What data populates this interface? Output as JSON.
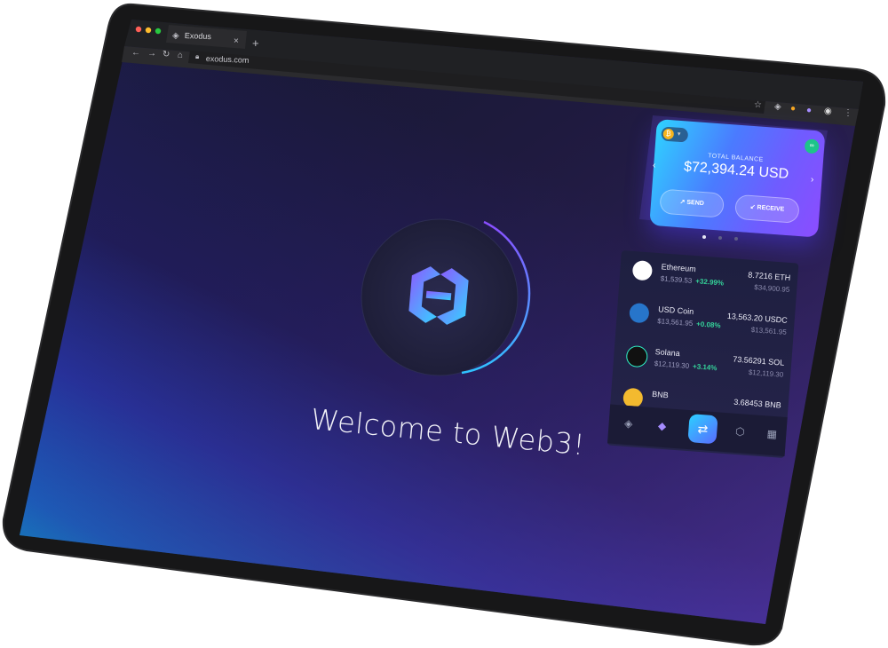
{
  "browser": {
    "tab_title": "Exodus",
    "url": "exodus.com",
    "new_tab_symbol": "+",
    "close_symbol": "×"
  },
  "main": {
    "welcome": "Welcome to Web3!"
  },
  "wallet": {
    "balance_label": "TOTAL BALANCE",
    "balance": "$72,394.24 USD",
    "send_label": "SEND",
    "receive_label": "RECEIVE",
    "assets": [
      {
        "name": "Ethereum",
        "price": "$1,539.53",
        "change": "+32.99%",
        "amount": "8.7216 ETH",
        "fiat": "$34,900.95",
        "icon": "ethereum-icon",
        "color": "#ffffff"
      },
      {
        "name": "USD Coin",
        "price": "$13,561.95",
        "change": "+0.08%",
        "amount": "13,563.20 USDC",
        "fiat": "$13,561.95",
        "icon": "usdc-icon",
        "color": "#2775ca"
      },
      {
        "name": "Solana",
        "price": "$12,119.30",
        "change": "+3.14%",
        "amount": "73.56291 SOL",
        "fiat": "$12,119.30",
        "icon": "solana-icon",
        "color": "#1a1a1a"
      },
      {
        "name": "BNB",
        "price": "",
        "change": "",
        "amount": "3.68453 BNB",
        "fiat": "",
        "icon": "bnb-icon",
        "color": "#f3ba2f"
      }
    ]
  },
  "colors": {
    "accent": "#5a6bff",
    "positive": "#34d39a"
  }
}
